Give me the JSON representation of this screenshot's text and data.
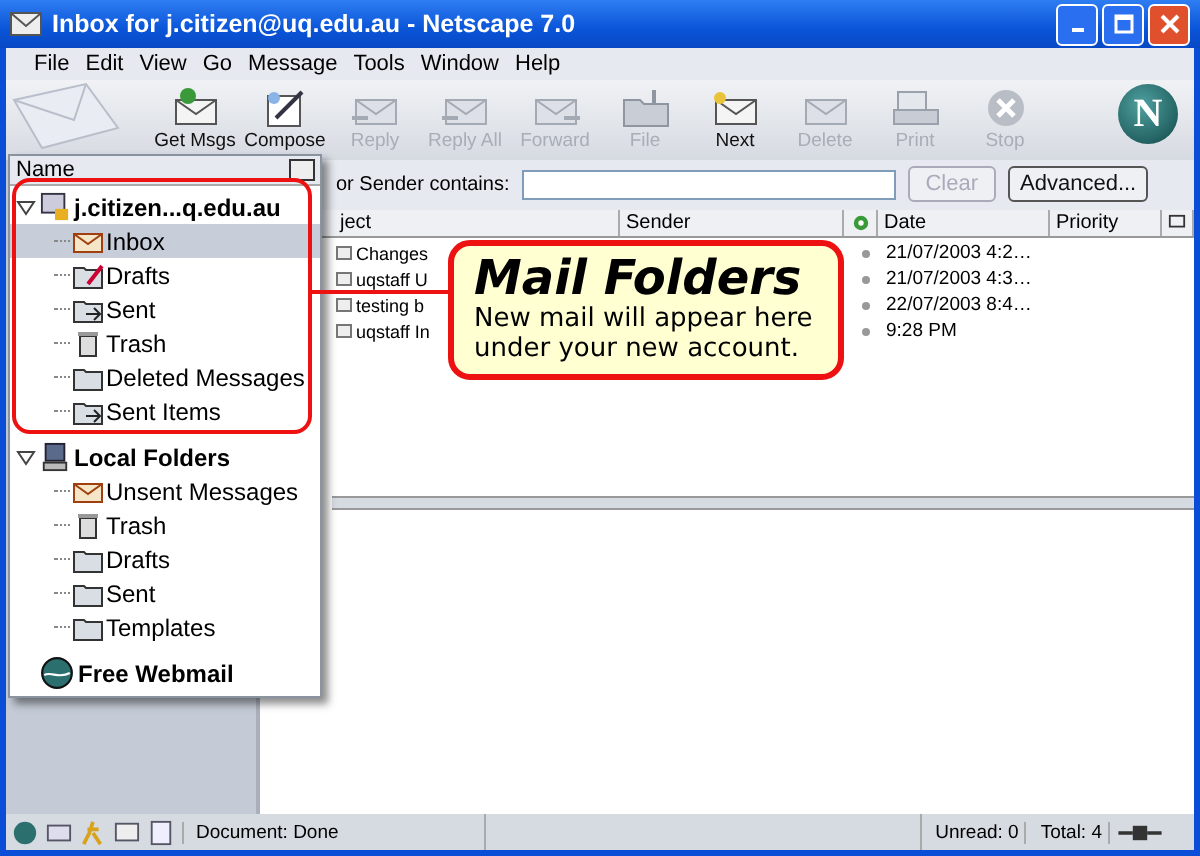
{
  "window": {
    "title": "Inbox for j.citizen@uq.edu.au - Netscape 7.0"
  },
  "menu": [
    "File",
    "Edit",
    "View",
    "Go",
    "Message",
    "Tools",
    "Window",
    "Help"
  ],
  "toolbar": [
    {
      "label": "Get Msgs",
      "kind": "get",
      "disabled": false
    },
    {
      "label": "Compose",
      "kind": "compose",
      "disabled": false
    },
    {
      "label": "Reply",
      "kind": "reply",
      "disabled": true
    },
    {
      "label": "Reply All",
      "kind": "reply",
      "disabled": true
    },
    {
      "label": "Forward",
      "kind": "forward",
      "disabled": true
    },
    {
      "label": "File",
      "kind": "file",
      "disabled": true
    },
    {
      "label": "Next",
      "kind": "next",
      "disabled": false
    },
    {
      "label": "Delete",
      "kind": "delete",
      "disabled": true
    },
    {
      "label": "Print",
      "kind": "print",
      "disabled": true
    },
    {
      "label": "Stop",
      "kind": "stop",
      "disabled": true
    }
  ],
  "throbber": {
    "letter": "N"
  },
  "folder_pane": {
    "header": "Name",
    "accounts": [
      {
        "name": "j.citizen...q.edu.au",
        "kind": "imap",
        "expanded": true,
        "children": [
          {
            "name": "Inbox",
            "kind": "inbox",
            "selected": true
          },
          {
            "name": "Drafts",
            "kind": "drafts",
            "selected": false
          },
          {
            "name": "Sent",
            "kind": "sent",
            "selected": false
          },
          {
            "name": "Trash",
            "kind": "trash",
            "selected": false
          },
          {
            "name": "Deleted Messages",
            "kind": "folder",
            "selected": false
          },
          {
            "name": "Sent Items",
            "kind": "sent",
            "selected": false
          }
        ]
      },
      {
        "name": "Local Folders",
        "kind": "local",
        "expanded": true,
        "children": [
          {
            "name": "Unsent Messages",
            "kind": "unsent",
            "selected": false
          },
          {
            "name": "Trash",
            "kind": "trash",
            "selected": false
          },
          {
            "name": "Drafts",
            "kind": "folder",
            "selected": false
          },
          {
            "name": "Sent",
            "kind": "folder",
            "selected": false
          },
          {
            "name": "Templates",
            "kind": "folder",
            "selected": false
          }
        ]
      },
      {
        "name": "Free Webmail",
        "kind": "webmail"
      }
    ]
  },
  "search": {
    "label": "or Sender contains:",
    "clear": {
      "label": "Clear",
      "disabled": true
    },
    "advanced": "Advanced..."
  },
  "columns": [
    "ject",
    "Sender",
    "Date",
    "Priority"
  ],
  "rows": [
    {
      "subject": "Changes",
      "date": "21/07/2003 4:2…"
    },
    {
      "subject": "uqstaff U",
      "date": "21/07/2003 4:3…"
    },
    {
      "subject": "testing b",
      "date": "22/07/2003 8:4…"
    },
    {
      "subject": "uqstaff In",
      "date": "9:28 PM"
    }
  ],
  "status": {
    "text": "Document: Done",
    "unread": "Unread: 0",
    "total": "Total: 4"
  },
  "callout": {
    "title": "Mail Folders",
    "text": "New mail will appear here under your new account."
  }
}
